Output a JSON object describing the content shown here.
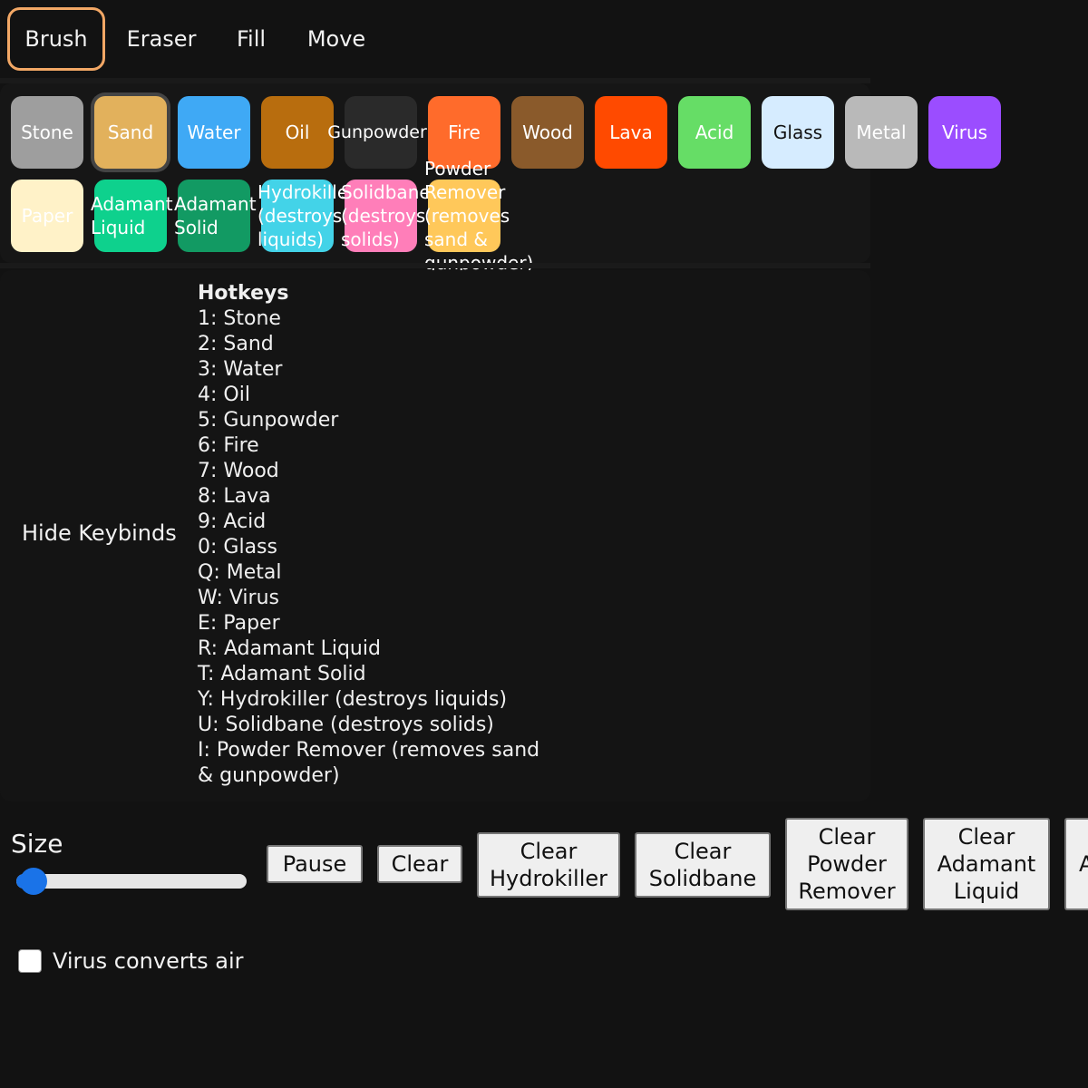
{
  "tools": [
    {
      "label": "Brush",
      "active": true
    },
    {
      "label": "Eraser",
      "active": false
    },
    {
      "label": "Fill",
      "active": false
    },
    {
      "label": "Move",
      "active": false
    }
  ],
  "materials": [
    {
      "label": "Stone",
      "color": "#9e9e9e",
      "selected": false
    },
    {
      "label": "Sand",
      "color": "#e2b15c",
      "selected": true
    },
    {
      "label": "Water",
      "color": "#3fa9f5",
      "selected": false
    },
    {
      "label": "Oil",
      "color": "#b86d0e",
      "selected": false
    },
    {
      "label": "Gunpowder",
      "color": "#2a2a2a",
      "selected": false
    },
    {
      "label": "Fire",
      "color": "#ff6b2b",
      "selected": false
    },
    {
      "label": "Wood",
      "color": "#8a5a2b",
      "selected": false
    },
    {
      "label": "Lava",
      "color": "#ff4a00",
      "selected": false
    },
    {
      "label": "Acid",
      "color": "#66dd66",
      "selected": false
    },
    {
      "label": "Glass",
      "color": "#d6ecff",
      "selected": false
    },
    {
      "label": "Metal",
      "color": "#b9b9b9",
      "selected": false
    },
    {
      "label": "Virus",
      "color": "#9b4dff",
      "selected": false
    },
    {
      "label": "Paper",
      "color": "#fff2c8",
      "selected": false
    },
    {
      "label": "Adamant Liquid",
      "color": "#0ed18d",
      "selected": false
    },
    {
      "label": "Adamant Solid",
      "color": "#129a63",
      "selected": false
    },
    {
      "label": "Hydrokiller (destroys liquids)",
      "color": "#43d3e8",
      "selected": false
    },
    {
      "label": "Solidbane (destroys solids)",
      "color": "#ff7eb9",
      "selected": false
    },
    {
      "label": "Powder Remover (removes sand & gunpowder)",
      "color": "#ffc85a",
      "selected": false
    }
  ],
  "keybinds": {
    "toggle_label": "Hide Keybinds",
    "title": "Hotkeys",
    "items": [
      "1: Stone",
      "2: Sand",
      "3: Water",
      "4: Oil",
      "5: Gunpowder",
      "6: Fire",
      "7: Wood",
      "8: Lava",
      "9: Acid",
      "0: Glass",
      "Q: Metal",
      "W: Virus",
      "E: Paper",
      "R: Adamant Liquid",
      "T: Adamant Solid",
      "Y: Hydrokiller (destroys liquids)",
      "U: Solidbane (destroys solids)",
      "I: Powder Remover (removes sand & gunpowder)"
    ]
  },
  "size": {
    "label": "Size",
    "value_fraction": 0.02
  },
  "buttons": {
    "pause": "Pause",
    "clear": "Clear",
    "clear_hydrokiller": "Clear Hydrokiller",
    "clear_solidbane": "Clear Solidbane",
    "clear_powder_remover": "Clear Powder Remover",
    "clear_adamant_liquid": "Clear Adamant Liquid",
    "partial_next": "A"
  },
  "virus_option": {
    "label": "Virus converts air",
    "checked": false
  }
}
